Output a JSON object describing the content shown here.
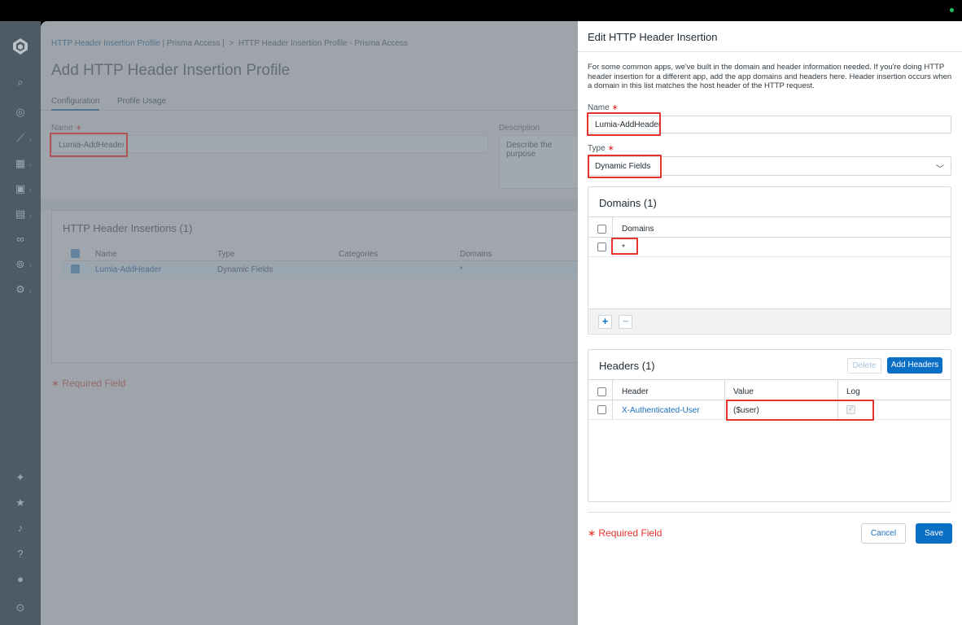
{
  "nav": {
    "items": [
      "search-icon",
      "bullseye-icon",
      "chart-icon",
      "dashboard-icon",
      "briefcase-icon",
      "user-badge-icon",
      "binoculars-icon",
      "magnify-settings-icon",
      "gear-icon"
    ],
    "bottom": [
      "sparkle-icon",
      "star-icon",
      "bell-icon",
      "help-icon",
      "user-icon",
      "collapse-icon"
    ]
  },
  "background_page": {
    "breadcrumb": {
      "link": "HTTP Header Insertion Profile",
      "scope": "| Prisma Access |",
      "separator": ">",
      "current": "HTTP Header Insertion Profile - Prisma Access"
    },
    "title": "Add HTTP Header Insertion Profile",
    "tabs": [
      "Configuration",
      "Profile Usage"
    ],
    "name_label": "Name",
    "name_value": "Lumia-AddHeader",
    "description_label": "Description",
    "description_placeholder": "Describe the purpose",
    "insertions": {
      "title": "HTTP Header Insertions (1)",
      "columns": [
        "Name",
        "Type",
        "Categories",
        "Domains"
      ],
      "rows": [
        {
          "name": "Lumia-AddHeader",
          "type": "Dynamic Fields",
          "categories": "",
          "domains": "*"
        }
      ]
    },
    "required_field": "Required Field"
  },
  "drawer": {
    "title": "Edit HTTP Header Insertion",
    "description": "For some common apps, we've built in the domain and header information needed. If you're doing HTTP header insertion for a different app, add the app domains and headers here. Header insertion occurs when a domain in this list matches the host header of the HTTP request.",
    "name_label": "Name",
    "name_value": "Lumia-AddHeader",
    "type_label": "Type",
    "type_value": "Dynamic Fields",
    "required_mark": "∗",
    "domains": {
      "title": "Domains (1)",
      "column": "Domains",
      "rows": [
        "*"
      ],
      "add": "+",
      "remove": "−"
    },
    "headers": {
      "title": "Headers (1)",
      "delete_label": "Delete",
      "add_label": "Add Headers",
      "columns": [
        "Header",
        "Value",
        "Log"
      ],
      "rows": [
        {
          "header": "X-Authenticated-User",
          "value": "($user)",
          "log": true
        }
      ]
    },
    "required_field": "Required Field",
    "cancel_label": "Cancel",
    "save_label": "Save"
  },
  "colors": {
    "accent": "#0b6fc6",
    "highlight": "#e5322d",
    "status_dot": "#23c45e"
  }
}
